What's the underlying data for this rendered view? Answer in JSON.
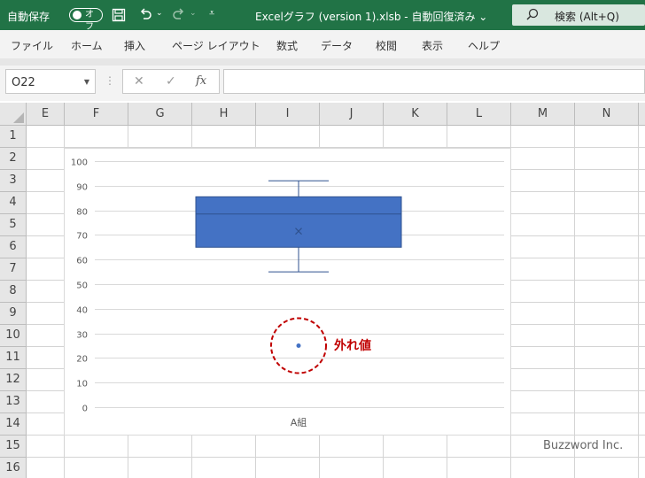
{
  "titlebar": {
    "autosave_label": "自動保存",
    "autosave_state": "オフ",
    "save_icon": "save-icon",
    "undo_icon": "undo-icon",
    "redo_icon": "redo-icon",
    "qat_icon": "customize-qat-icon",
    "doc_title": "Excelグラフ (version 1).xlsb  -  自動回復済み  ⌄",
    "search_text": "検索 (Alt+Q)",
    "accent": "#217346"
  },
  "menu": {
    "items": [
      "ファイル",
      "ホーム",
      "挿入",
      "ページ レイアウト",
      "数式",
      "データ",
      "校閲",
      "表示",
      "ヘルプ"
    ]
  },
  "formula_bar": {
    "name_box": "O22",
    "cancel": "✕",
    "enter": "✓",
    "fx": "fx",
    "value": ""
  },
  "sheet": {
    "columns": [
      "E",
      "F",
      "G",
      "H",
      "I",
      "J",
      "K",
      "L",
      "M",
      "N"
    ],
    "rows": [
      "1",
      "2",
      "3",
      "4",
      "5",
      "6",
      "7",
      "8",
      "9",
      "10",
      "11",
      "12",
      "13",
      "14",
      "15",
      "16"
    ]
  },
  "chart_data": {
    "type": "box",
    "categories": [
      "A組"
    ],
    "yticks": [
      "100",
      "90",
      "80",
      "70",
      "60",
      "50",
      "40",
      "30",
      "20",
      "10",
      "0"
    ],
    "ylim": [
      0,
      100
    ],
    "box": {
      "min": 55,
      "q1": 65,
      "median": 78.5,
      "mean": 71.5,
      "q3": 85.5,
      "max": 92
    },
    "outliers": [
      25
    ],
    "box_color": "#4472c4",
    "grid": true,
    "annotation": "外れ値",
    "annotation_color": "#c00000"
  },
  "watermark": "Buzzword Inc."
}
